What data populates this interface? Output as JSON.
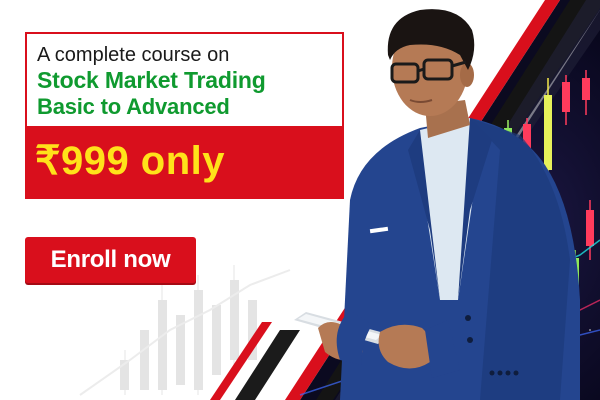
{
  "headline": {
    "line1": "A complete course on",
    "line2": "Stock Market Trading",
    "line3": "Basic to Advanced"
  },
  "price": "₹999 only",
  "cta": {
    "label": "Enroll now"
  },
  "colors": {
    "brand_red": "#d90f1c",
    "headline_green": "#0f9a2f",
    "price_yellow": "#ffe21a",
    "suit_blue": "#24458f",
    "chart_dark": "#0e0b22"
  },
  "icons": [
    "candlestick-chart-graphic",
    "tablet-device"
  ]
}
